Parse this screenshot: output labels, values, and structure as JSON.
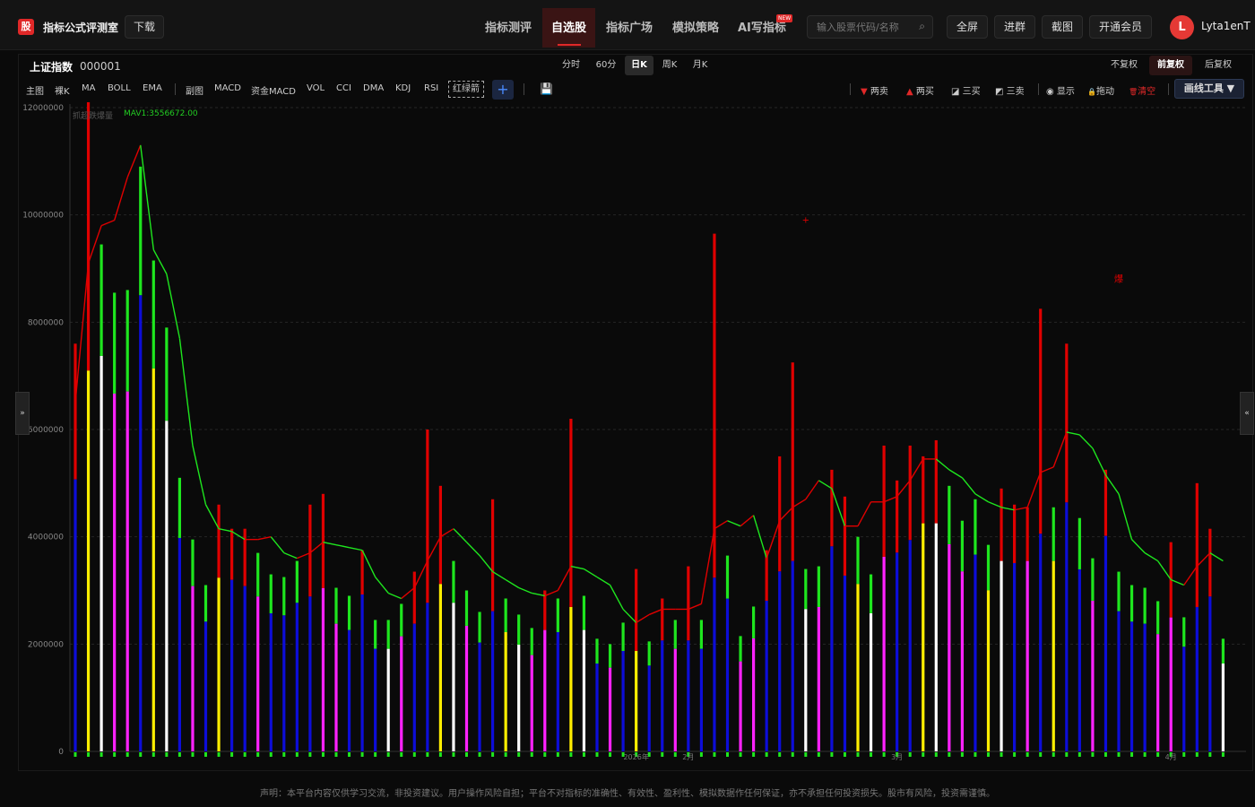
{
  "app": {
    "logo_char": "股",
    "title": "指标公式评测室",
    "download_label": "下载"
  },
  "nav": {
    "items": [
      "指标测评",
      "自选股",
      "指标广场",
      "模拟策略",
      "AI写指标"
    ],
    "active_index": 1,
    "new_badge": "NEW",
    "search_placeholder": "输入股票代码/名称",
    "buttons": [
      "全屏",
      "进群",
      "截图",
      "开通会员"
    ],
    "user": {
      "initial": "L",
      "name": "Lyta1enT"
    }
  },
  "stock": {
    "name": "上证指数",
    "code": "000001"
  },
  "periods": {
    "items": [
      "分时",
      "60分",
      "日K",
      "周K",
      "月K"
    ],
    "active": "日K"
  },
  "adjust": {
    "items": [
      "不复权",
      "前复权",
      "后复权"
    ],
    "active": "前复权"
  },
  "toolbar": {
    "main_items": [
      "主图",
      "裸K",
      "MA",
      "BOLL",
      "EMA"
    ],
    "sub_items": [
      "副图",
      "MACD",
      "资金MACD",
      "VOL",
      "CCI",
      "DMA",
      "KDJ",
      "RSI"
    ],
    "boxed_item": "红绿箭",
    "plus": "+",
    "draw_items": [
      {
        "label": "两卖",
        "icon": "▼",
        "color": "#e02828"
      },
      {
        "label": "两买",
        "icon": "▲",
        "color": "#e02828"
      },
      {
        "label": "三买",
        "icon": "◪",
        "color": "#cccccc"
      },
      {
        "label": "三卖",
        "icon": "◩",
        "color": "#cccccc"
      },
      {
        "label": "显示",
        "icon": "◉",
        "color": "#cccccc"
      },
      {
        "label": "拖动",
        "icon": "🔒",
        "color": "#cccccc"
      },
      {
        "label": "清空",
        "icon": "🗑",
        "color": "#e02828"
      }
    ],
    "draw_tools": "画线工具 ▼"
  },
  "legend": {
    "name": "抓超跌爆量",
    "mav": "MAV1:3556672.00"
  },
  "side_toggles": {
    "left": "»",
    "right": "«"
  },
  "chart_data": {
    "type": "bar",
    "ylim": [
      0,
      12000000
    ],
    "yticks": [
      0,
      2000000,
      4000000,
      6000000,
      8000000,
      10000000,
      12000000
    ],
    "x_markers": [
      {
        "index": 43,
        "label": "2026年"
      },
      {
        "index": 47,
        "label": "2月"
      },
      {
        "index": 63,
        "label": "3月"
      },
      {
        "index": 84,
        "label": "4月"
      }
    ],
    "annotations": [
      {
        "index": 56,
        "value": 9850000,
        "text": "+"
      },
      {
        "index": 80,
        "value": 8750000,
        "text": "爆"
      }
    ],
    "series": [
      {
        "name": "VOL",
        "values": [
          7600000,
          12100000,
          9450000,
          8550000,
          8600000,
          10900000,
          9150000,
          7900000,
          5100000,
          3950000,
          3100000,
          4600000,
          4150000,
          4150000,
          3700000,
          3300000,
          3250000,
          3550000,
          4600000,
          4800000,
          3050000,
          2900000,
          3750000,
          2450000,
          2450000,
          2750000,
          3350000,
          6000000,
          4950000,
          3550000,
          3000000,
          2600000,
          4700000,
          2850000,
          2550000,
          2300000,
          3000000,
          2850000,
          6200000,
          2900000,
          2100000,
          2000000,
          2400000,
          3400000,
          2050000,
          2850000,
          2450000,
          3450000,
          2450000,
          9650000,
          3650000,
          2150000,
          2700000,
          3750000,
          5500000,
          7250000,
          3400000,
          3450000,
          5250000,
          4750000,
          4000000,
          3300000,
          5700000,
          5050000,
          5700000,
          5500000,
          5800000,
          4950000,
          4300000,
          4700000,
          3850000,
          4900000,
          4600000,
          4550000,
          8250000,
          4550000,
          7600000,
          4350000,
          3600000,
          5250000,
          3350000,
          3100000,
          3050000,
          2800000,
          3900000,
          2500000,
          5000000,
          4150000,
          2100000
        ]
      },
      {
        "name": "MAV1",
        "values": [
          6500000,
          9100000,
          9800000,
          9900000,
          10700000,
          11300000,
          9350000,
          8900000,
          7700000,
          5700000,
          4600000,
          4150000,
          4100000,
          3950000,
          3950000,
          4000000,
          3700000,
          3600000,
          3700000,
          3900000,
          3850000,
          3800000,
          3750000,
          3250000,
          2950000,
          2850000,
          3050000,
          3550000,
          4000000,
          4150000,
          3900000,
          3650000,
          3350000,
          3200000,
          3050000,
          2950000,
          2900000,
          3000000,
          3450000,
          3400000,
          3250000,
          3100000,
          2650000,
          2400000,
          2550000,
          2650000,
          2650000,
          2650000,
          2750000,
          4150000,
          4300000,
          4200000,
          4400000,
          3600000,
          4300000,
          4550000,
          4700000,
          5050000,
          4900000,
          4200000,
          4200000,
          4650000,
          4650000,
          4750000,
          5050000,
          5450000,
          5450000,
          5250000,
          5100000,
          4800000,
          4650000,
          4550000,
          4500000,
          4550000,
          5200000,
          5300000,
          5950000,
          5900000,
          5650000,
          5150000,
          4800000,
          3950000,
          3700000,
          3550000,
          3200000,
          3100000,
          3450000,
          3700000,
          3550000
        ]
      }
    ]
  },
  "disclaimer": "声明：本平台内容仅供学习交流，非投资建议。用户操作风险自担；平台不对指标的准确性、有效性、盈利性、模拟数据作任何保证，亦不承担任何投资损失。股市有风险，投资需谨慎。"
}
